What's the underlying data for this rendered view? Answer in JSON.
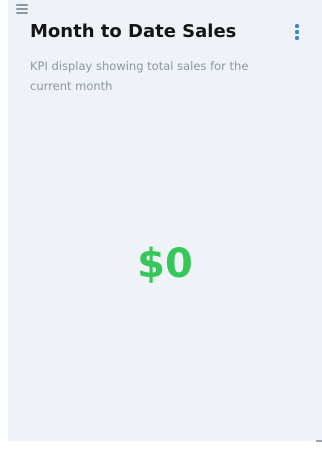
{
  "widget": {
    "title": "Month to Date Sales",
    "description": "KPI display showing total sales for the current month",
    "kpi_value": "$0",
    "kpi_color": "#35c759",
    "menu_icon": "kebab-menu-icon",
    "drag_icon": "drag-handle-icon"
  }
}
